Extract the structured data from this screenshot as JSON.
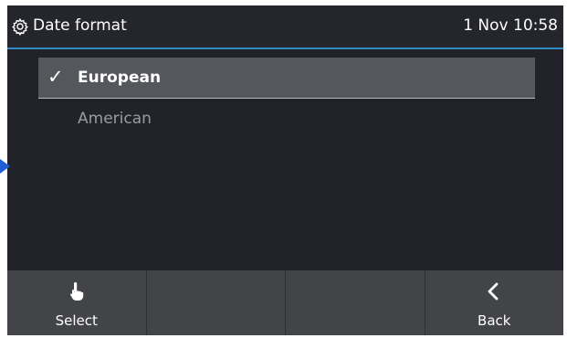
{
  "header": {
    "title": "Date format",
    "clock": "1 Nov 10:58",
    "icon": "gear-icon"
  },
  "options": [
    {
      "label": "European",
      "selected": true,
      "check": "✓"
    },
    {
      "label": "American",
      "selected": false
    }
  ],
  "softkeys": [
    {
      "label": "Select",
      "icon": "hand-pointer-icon"
    },
    {
      "label": ""
    },
    {
      "label": ""
    },
    {
      "label": "Back",
      "icon": "chevron-left-icon"
    }
  ],
  "colors": {
    "accent_line": "#2f88c4",
    "background": "#22232a",
    "softkey_bar": "#434447",
    "selection": "#55575c",
    "marker": "#1f5fd6"
  }
}
